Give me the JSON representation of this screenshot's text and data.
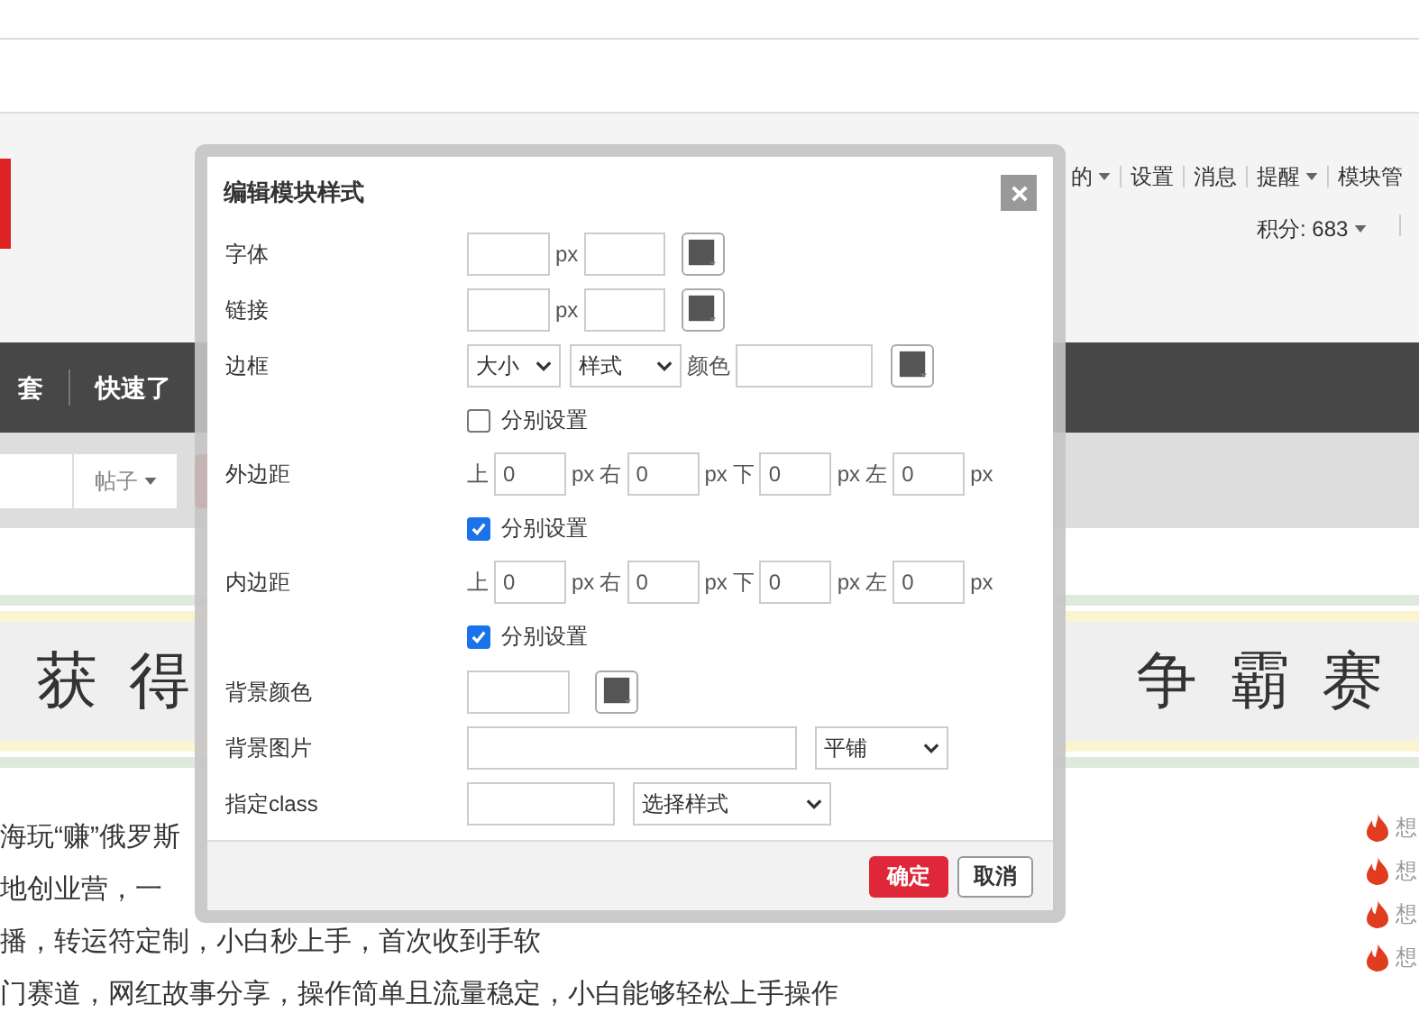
{
  "top_links": [
    {
      "label": "的",
      "caret": true
    },
    {
      "label": "设置",
      "caret": false
    },
    {
      "label": "消息",
      "caret": false
    },
    {
      "label": "提醒",
      "caret": true
    },
    {
      "label": "模块管",
      "caret": false
    }
  ],
  "points": "积分: 683",
  "nav": [
    "套",
    "快速了"
  ],
  "search": {
    "type_select": "帖子"
  },
  "banner": {
    "left": "获 得",
    "right": "争 霸 赛"
  },
  "article_lines": [
    "海玩“赚”俄罗斯",
    "地创业营，一",
    "播，转运符定制，小白秒上手，首次收到手软",
    "门赛道，网红故事分享，操作简单且流量稳定，小白能够轻松上手操作"
  ],
  "side_items": [
    "想",
    "想",
    "想",
    "想"
  ],
  "dialog": {
    "title": "编辑模块样式",
    "rows": [
      {
        "kind": "size_color",
        "label": "字体",
        "unit": "px"
      },
      {
        "kind": "size_color",
        "label": "链接",
        "unit": "px"
      },
      {
        "kind": "border",
        "label": "边框",
        "size_select": "大小",
        "style_select": "样式",
        "color_label": "颜色"
      },
      {
        "kind": "checkbox",
        "label": "分别设置",
        "checked": false
      },
      {
        "kind": "sides",
        "label": "外边距",
        "sides": [
          {
            "label": "上",
            "value": "0",
            "unit": "px"
          },
          {
            "label": "右",
            "value": "0",
            "unit": "px"
          },
          {
            "label": "下",
            "value": "0",
            "unit": "px"
          },
          {
            "label": "左",
            "value": "0",
            "unit": "px"
          }
        ]
      },
      {
        "kind": "checkbox",
        "label": "分别设置",
        "checked": true
      },
      {
        "kind": "sides",
        "label": "内边距",
        "sides": [
          {
            "label": "上",
            "value": "0",
            "unit": "px"
          },
          {
            "label": "右",
            "value": "0",
            "unit": "px"
          },
          {
            "label": "下",
            "value": "0",
            "unit": "px"
          },
          {
            "label": "左",
            "value": "0",
            "unit": "px"
          }
        ]
      },
      {
        "kind": "checkbox",
        "label": "分别设置",
        "checked": true
      },
      {
        "kind": "color",
        "label": "背景颜色"
      },
      {
        "kind": "image",
        "label": "背景图片",
        "select": "平铺"
      },
      {
        "kind": "class",
        "label": "指定class",
        "select": "选择样式"
      }
    ],
    "buttons": [
      {
        "label": "确定",
        "primary": true
      },
      {
        "label": "取消",
        "primary": false
      }
    ]
  }
}
